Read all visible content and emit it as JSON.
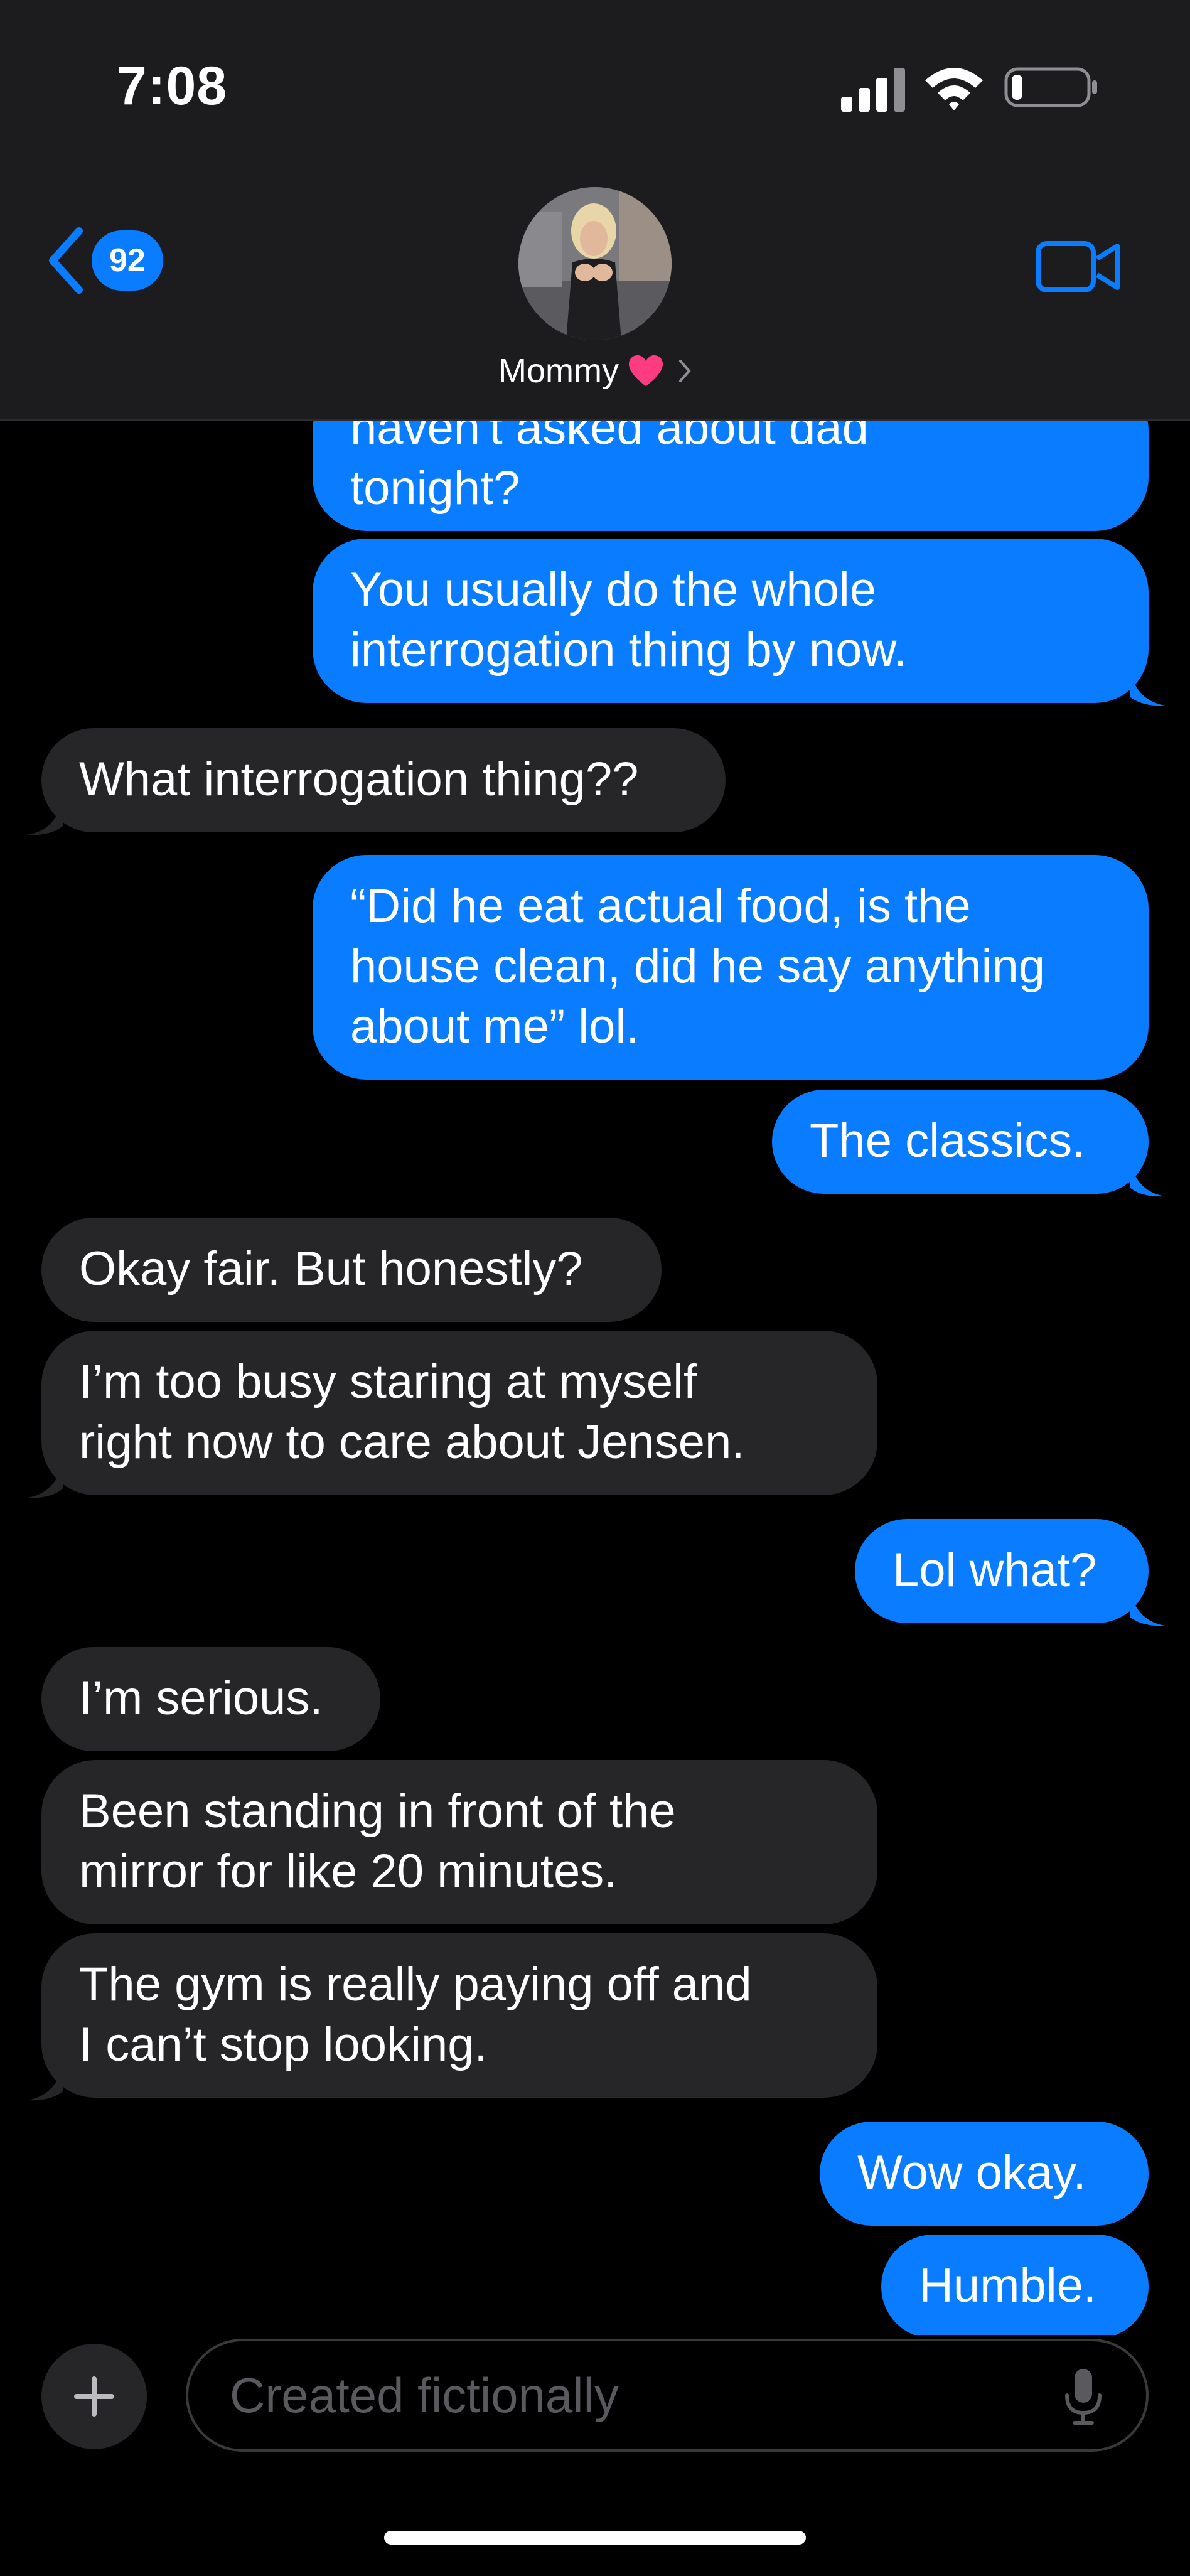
{
  "status_bar": {
    "time": "7:08",
    "battery_level": 0.15
  },
  "header": {
    "back_badge_count": "92",
    "contact_name": "Mommy",
    "heart_icon": "pink-heart-icon",
    "video_icon": "video-camera-icon",
    "accent_color": "#0a7cff"
  },
  "messages": [
    {
      "direction": "outgoing",
      "text": "haven't asked about dad\ntonight?"
    },
    {
      "direction": "outgoing",
      "text": "You usually do the whole\ninterrogation thing by now."
    },
    {
      "direction": "incoming",
      "text": "What interrogation thing??"
    },
    {
      "direction": "outgoing",
      "text": "“Did he eat actual food, is the\nhouse clean, did he say anything\nabout me” lol."
    },
    {
      "direction": "outgoing",
      "text": "The classics."
    },
    {
      "direction": "incoming",
      "text": "Okay fair. But honestly?"
    },
    {
      "direction": "incoming",
      "text": "I’m too busy staring at myself\nright now to care about Jensen."
    },
    {
      "direction": "outgoing",
      "text": "Lol what?"
    },
    {
      "direction": "incoming",
      "text": "I’m serious."
    },
    {
      "direction": "incoming",
      "text": "Been standing in front of the\nmirror for like 20 minutes."
    },
    {
      "direction": "incoming",
      "text": "The gym is really paying off and\nI can’t stop looking."
    },
    {
      "direction": "outgoing",
      "text": "Wow okay."
    },
    {
      "direction": "outgoing",
      "text": "Humble."
    }
  ],
  "composer": {
    "placeholder": "Created fictionally"
  },
  "colors": {
    "outgoing": "#0a7cff",
    "incoming": "#262628",
    "background": "#000000",
    "header": "#1c1c1e"
  }
}
